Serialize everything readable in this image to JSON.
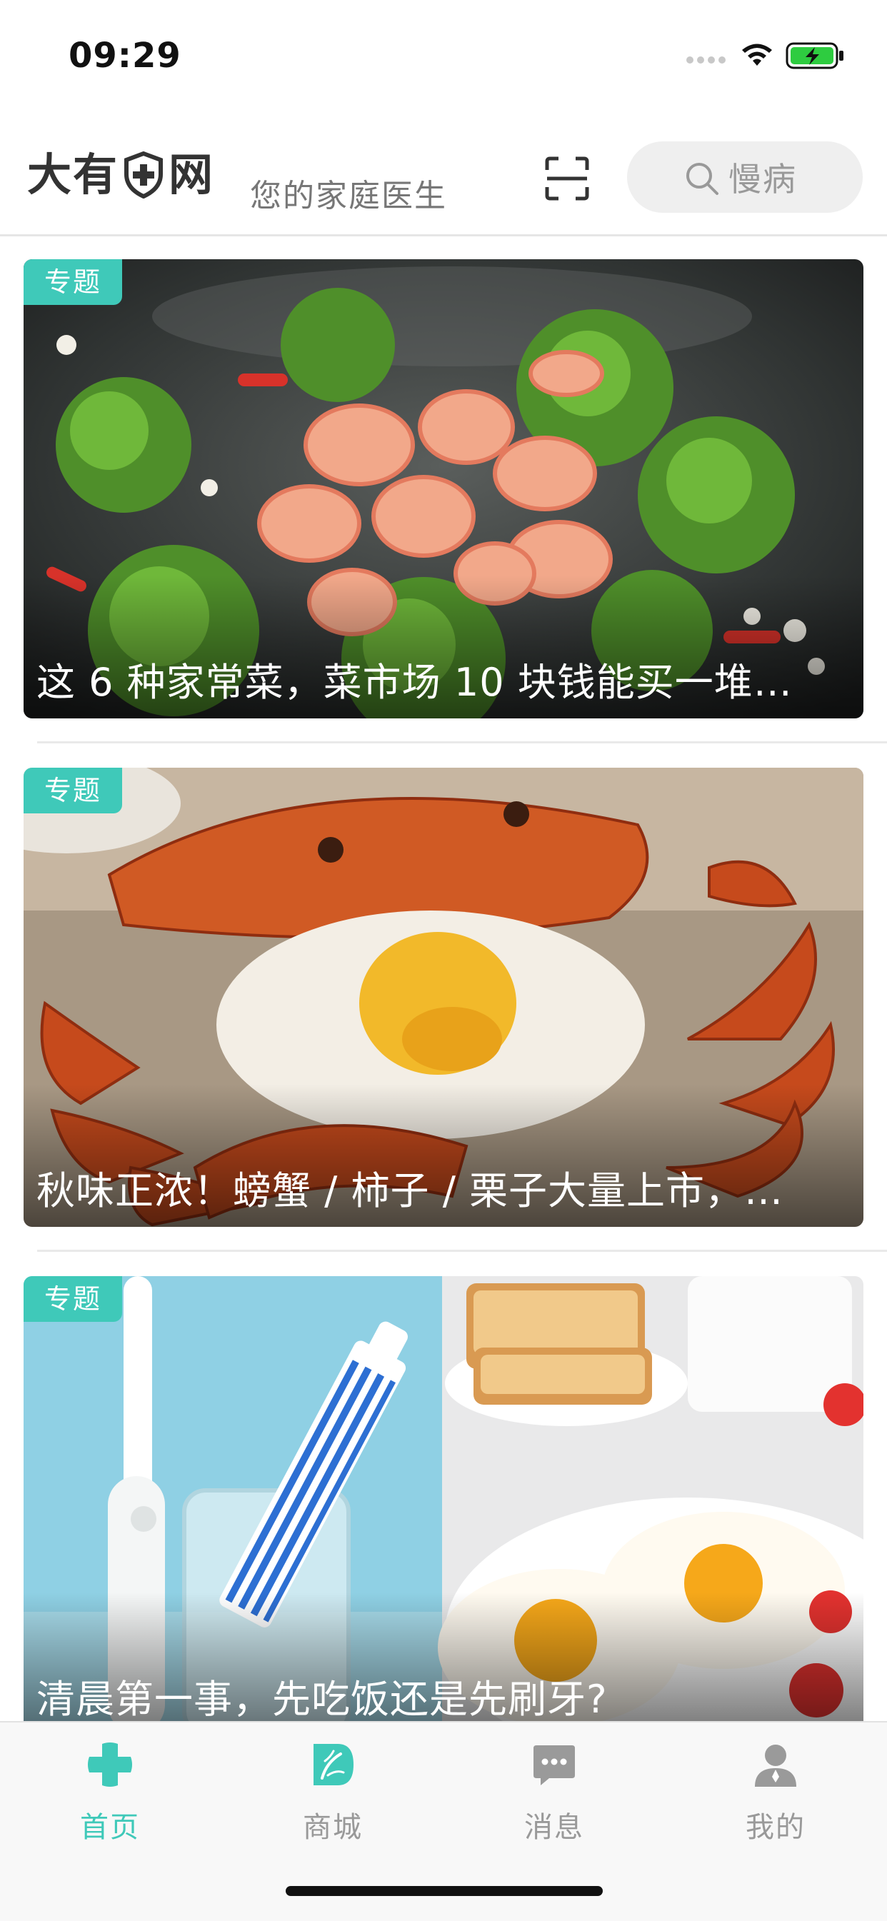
{
  "status_bar": {
    "time": "09:29"
  },
  "header": {
    "logo_left": "大有",
    "logo_right": "网",
    "slogan": "您的家庭医生",
    "search_placeholder": "慢病"
  },
  "feed": {
    "cards": [
      {
        "tag": "专题",
        "title": "这 6 种家常菜，菜市场 10 块钱能买一堆…"
      },
      {
        "tag": "专题",
        "title": "秋味正浓！螃蟹 / 柿子 / 栗子大量上市，…"
      },
      {
        "tag": "专题",
        "title": "清晨第一事，先吃饭还是先刷牙?"
      }
    ]
  },
  "tab_bar": {
    "tabs": [
      {
        "label": "首页",
        "icon": "medical-cross-icon",
        "active": true
      },
      {
        "label": "商城",
        "icon": "store-logo-icon",
        "active": false
      },
      {
        "label": "消息",
        "icon": "chat-bubble-icon",
        "active": false
      },
      {
        "label": "我的",
        "icon": "user-icon",
        "active": false
      }
    ]
  },
  "colors": {
    "accent": "#3fc9b9",
    "inactive": "#999999"
  }
}
